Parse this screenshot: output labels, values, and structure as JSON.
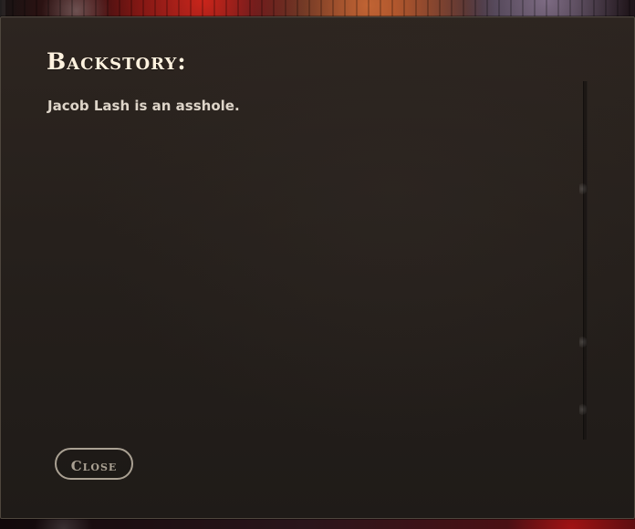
{
  "modal": {
    "title": "Backstory:",
    "story": "Jacob Lash is an asshole.",
    "close_label": "Close"
  },
  "colors": {
    "modal_background": "#241f1b",
    "modal_border": "#4e463d",
    "title_text": "#fff2df",
    "body_text": "#ded5c9",
    "button_text": "#aaa193"
  },
  "icons": {
    "scrollbar": "vertical-scrollbar"
  }
}
